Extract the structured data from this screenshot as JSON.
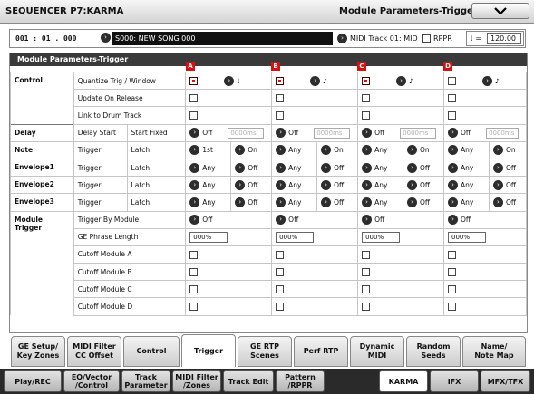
{
  "header": {
    "mode_title": "SEQUENCER P7:KARMA",
    "page_title": "Module Parameters-Trigger",
    "menu_icon": "chevron-down-icon"
  },
  "songbar": {
    "location": "001 : 01 . 000",
    "song": "S000: NEW SONG 000",
    "midi_track": "MIDI Track 01: MID",
    "rppr_label": "RPPR",
    "rppr_checked": false,
    "tempo_symbol": "♩ =",
    "tempo": "120.00"
  },
  "panel": {
    "title": "Module Parameters-Trigger",
    "modules": [
      "A",
      "B",
      "C",
      "D"
    ],
    "tag_color": "#d81010"
  },
  "rows": {
    "control": {
      "group": "Control",
      "quantize": {
        "label": "Quantize Trig / Window",
        "values": [
          "♩",
          "♪",
          "♪",
          "♪"
        ],
        "checked": [
          true,
          true,
          true,
          false
        ]
      },
      "update": {
        "label": "Update On Release",
        "checked": [
          false,
          false,
          false,
          false
        ]
      },
      "link": {
        "label": "Link to Drum Track",
        "checked": [
          false,
          false,
          false,
          false
        ]
      }
    },
    "delay": {
      "group": "Delay",
      "label": "Delay Start",
      "sub": "Start Fixed",
      "values": [
        "Off",
        "Off",
        "Off",
        "Off"
      ],
      "ms": "0000ms"
    },
    "note": {
      "group": "Note",
      "label": "Trigger",
      "sub": "Latch",
      "triggers": [
        "1st",
        "Any",
        "Any",
        "Any"
      ],
      "latches": [
        "On",
        "On",
        "On",
        "On"
      ]
    },
    "env1": {
      "group": "Envelope1",
      "label": "Trigger",
      "sub": "Latch",
      "triggers": [
        "Any",
        "Any",
        "Any",
        "Any"
      ],
      "latches": [
        "Off",
        "Off",
        "Off",
        "Off"
      ]
    },
    "env2": {
      "group": "Envelope2",
      "label": "Trigger",
      "sub": "Latch",
      "triggers": [
        "Any",
        "Any",
        "Any",
        "Any"
      ],
      "latches": [
        "Off",
        "Off",
        "Off",
        "Off"
      ]
    },
    "env3": {
      "group": "Envelope3",
      "label": "Trigger",
      "sub": "Latch",
      "triggers": [
        "Any",
        "Any",
        "Any",
        "Any"
      ],
      "latches": [
        "Off",
        "Off",
        "Off",
        "Off"
      ]
    },
    "module_trigger": {
      "group": "Module Trigger",
      "by_module": {
        "label": "Trigger By Module",
        "values": [
          "Off",
          "Off",
          "Off",
          "Off"
        ]
      },
      "ge_length": {
        "label": "GE Phrase Length",
        "values": [
          "000%",
          "000%",
          "000%",
          "000%"
        ]
      },
      "cutoff_a": {
        "label": "Cutoff Module A"
      },
      "cutoff_b": {
        "label": "Cutoff Module B"
      },
      "cutoff_c": {
        "label": "Cutoff Module C"
      },
      "cutoff_d": {
        "label": "Cutoff Module D"
      }
    }
  },
  "tabs": [
    {
      "line1": "GE Setup/",
      "line2": "Key Zones"
    },
    {
      "line1": "MIDI Filter",
      "line2": "CC Offset"
    },
    {
      "line1": "Control",
      "line2": ""
    },
    {
      "line1": "Trigger",
      "line2": ""
    },
    {
      "line1": "GE RTP",
      "line2": "Scenes"
    },
    {
      "line1": "Perf RTP",
      "line2": ""
    },
    {
      "line1": "Dynamic",
      "line2": "MIDI"
    },
    {
      "line1": "Random",
      "line2": "Seeds"
    },
    {
      "line1": "Name/",
      "line2": "Note Map"
    }
  ],
  "modes": [
    {
      "line1": "Play/REC",
      "line2": ""
    },
    {
      "line1": "EQ/Vector",
      "line2": "/Control"
    },
    {
      "line1": "Track",
      "line2": "Parameter"
    },
    {
      "line1": "MIDI Filter",
      "line2": "/Zones"
    },
    {
      "line1": "Track Edit",
      "line2": ""
    },
    {
      "line1": "Pattern",
      "line2": "/RPPR"
    },
    {
      "line1": "KARMA",
      "line2": ""
    },
    {
      "line1": "IFX",
      "line2": ""
    },
    {
      "line1": "MFX/TFX",
      "line2": ""
    }
  ]
}
